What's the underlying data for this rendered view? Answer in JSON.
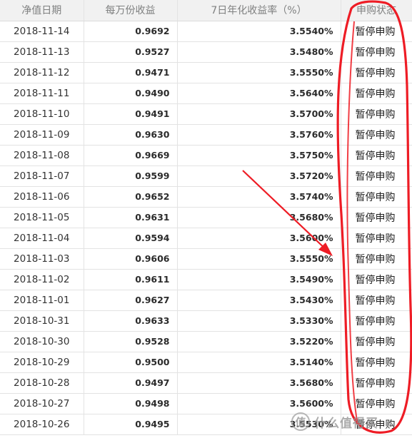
{
  "table": {
    "headers": {
      "date": "净值日期",
      "nav": "每万份收益",
      "yield": "7日年化收益率（%）",
      "status": "申购状态"
    },
    "rows": [
      {
        "date": "2018-11-14",
        "nav": "0.9692",
        "yield": "3.5540%",
        "status": "暂停申购"
      },
      {
        "date": "2018-11-13",
        "nav": "0.9527",
        "yield": "3.5480%",
        "status": "暂停申购"
      },
      {
        "date": "2018-11-12",
        "nav": "0.9471",
        "yield": "3.5550%",
        "status": "暂停申购"
      },
      {
        "date": "2018-11-11",
        "nav": "0.9490",
        "yield": "3.5640%",
        "status": "暂停申购"
      },
      {
        "date": "2018-11-10",
        "nav": "0.9491",
        "yield": "3.5700%",
        "status": "暂停申购"
      },
      {
        "date": "2018-11-09",
        "nav": "0.9630",
        "yield": "3.5760%",
        "status": "暂停申购"
      },
      {
        "date": "2018-11-08",
        "nav": "0.9669",
        "yield": "3.5750%",
        "status": "暂停申购"
      },
      {
        "date": "2018-11-07",
        "nav": "0.9599",
        "yield": "3.5720%",
        "status": "暂停申购"
      },
      {
        "date": "2018-11-06",
        "nav": "0.9652",
        "yield": "3.5740%",
        "status": "暂停申购"
      },
      {
        "date": "2018-11-05",
        "nav": "0.9631",
        "yield": "3.5680%",
        "status": "暂停申购"
      },
      {
        "date": "2018-11-04",
        "nav": "0.9594",
        "yield": "3.5600%",
        "status": "暂停申购"
      },
      {
        "date": "2018-11-03",
        "nav": "0.9606",
        "yield": "3.5550%",
        "status": "暂停申购"
      },
      {
        "date": "2018-11-02",
        "nav": "0.9611",
        "yield": "3.5490%",
        "status": "暂停申购"
      },
      {
        "date": "2018-11-01",
        "nav": "0.9627",
        "yield": "3.5430%",
        "status": "暂停申购"
      },
      {
        "date": "2018-10-31",
        "nav": "0.9633",
        "yield": "3.5330%",
        "status": "暂停申购"
      },
      {
        "date": "2018-10-30",
        "nav": "0.9528",
        "yield": "3.5220%",
        "status": "暂停申购"
      },
      {
        "date": "2018-10-29",
        "nav": "0.9500",
        "yield": "3.5140%",
        "status": "暂停申购"
      },
      {
        "date": "2018-10-28",
        "nav": "0.9497",
        "yield": "3.5680%",
        "status": "暂停申购"
      },
      {
        "date": "2018-10-27",
        "nav": "0.9498",
        "yield": "3.5600%",
        "status": "暂停申购"
      },
      {
        "date": "2018-10-26",
        "nav": "0.9495",
        "yield": "3.5530%",
        "status": "暂停申购"
      }
    ]
  },
  "watermark": {
    "logo_char": "值",
    "text": "什么值得买"
  },
  "colors": {
    "header_bg": "#f1f1f1",
    "annotation_red": "#ee1c25",
    "grid": "#e3e3e3"
  }
}
